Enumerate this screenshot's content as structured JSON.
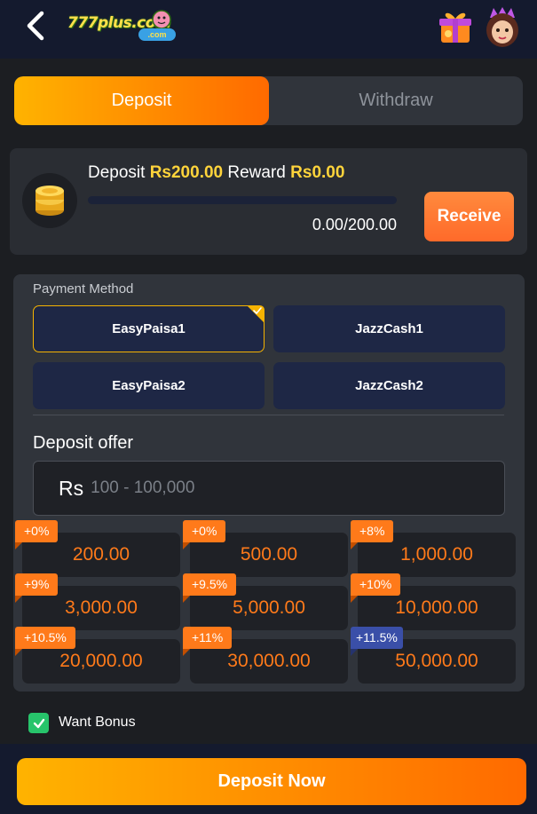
{
  "header": {
    "logo_text": "777plus.com",
    "logo_sub": ".com",
    "back_icon": "chevron-left-icon",
    "gift_icon": "gift-box-icon",
    "avatar_icon": "user-avatar-icon"
  },
  "tabs": [
    {
      "label": "Deposit",
      "active": true
    },
    {
      "label": "Withdraw",
      "active": false
    }
  ],
  "reward": {
    "deposit_label": "Deposit",
    "deposit_amount": "Rs200.00",
    "reward_label": "Reward",
    "reward_amount": "Rs0.00",
    "progress_text": "0.00/200.00",
    "progress_fraction": 0,
    "receive_label": "Receive",
    "coin_icon": "coin-stack-icon"
  },
  "payment": {
    "label": "Payment Method",
    "methods": [
      {
        "label": "EasyPaisa1",
        "selected": true
      },
      {
        "label": "JazzCash1",
        "selected": false
      },
      {
        "label": "EasyPaisa2",
        "selected": false
      },
      {
        "label": "JazzCash2",
        "selected": false
      }
    ]
  },
  "offer": {
    "title": "Deposit offer",
    "currency": "Rs",
    "placeholder": "100 - 100,000",
    "amounts": [
      {
        "bonus": "+0%",
        "value": "200.00"
      },
      {
        "bonus": "+0%",
        "value": "500.00"
      },
      {
        "bonus": "+8%",
        "value": "1,000.00"
      },
      {
        "bonus": "+9%",
        "value": "3,000.00"
      },
      {
        "bonus": "+9.5%",
        "value": "5,000.00"
      },
      {
        "bonus": "+10%",
        "value": "10,000.00"
      },
      {
        "bonus": "+10.5%",
        "value": "20,000.00"
      },
      {
        "bonus": "+11%",
        "value": "30,000.00"
      },
      {
        "bonus": "+11.5%",
        "value": "50,000.00"
      }
    ]
  },
  "bonus": {
    "label": "Want Bonus",
    "checked": true
  },
  "footer": {
    "deposit_now_label": "Deposit Now"
  },
  "colors": {
    "accent_orange": "#ff7a1a",
    "accent_yellow": "#ffd43b",
    "selected_border": "#f5b301",
    "check_green": "#27c46b",
    "badge_blue": "#3a4fa8"
  }
}
